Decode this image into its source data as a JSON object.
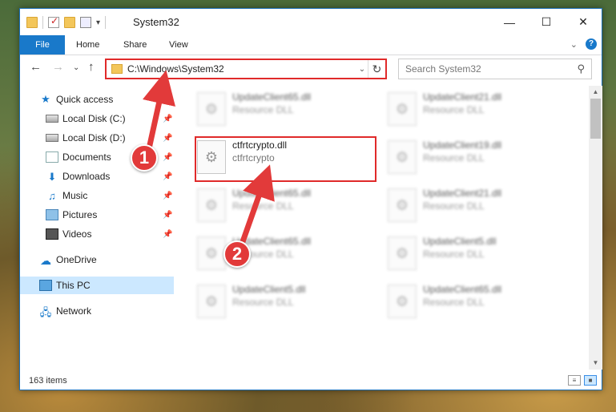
{
  "window": {
    "title": "System32"
  },
  "ribbon": {
    "tabs": [
      "File",
      "Home",
      "Share",
      "View"
    ],
    "help": "?"
  },
  "address": {
    "path": "C:\\Windows\\System32"
  },
  "search": {
    "placeholder": "Search System32"
  },
  "nav": {
    "items": [
      {
        "label": "Quick access",
        "icon": "star-icon"
      },
      {
        "label": "Local Disk (C:)",
        "icon": "drive-icon"
      },
      {
        "label": "Local Disk (D:)",
        "icon": "drive-icon"
      },
      {
        "label": "Documents",
        "icon": "documents-icon"
      },
      {
        "label": "Downloads",
        "icon": "downloads-icon"
      },
      {
        "label": "Music",
        "icon": "music-icon"
      },
      {
        "label": "Pictures",
        "icon": "pictures-icon"
      },
      {
        "label": "Videos",
        "icon": "videos-icon"
      },
      {
        "label": "OneDrive",
        "icon": "cloud-icon"
      },
      {
        "label": "This PC",
        "icon": "computer-icon"
      },
      {
        "label": "Network",
        "icon": "network-icon"
      }
    ]
  },
  "files": [
    {
      "name": "UpdateClient65.dll",
      "type": "Resource DLL"
    },
    {
      "name": "UpdateClient21.dll",
      "type": "Resource DLL"
    },
    {
      "name": "ctfrtcrypto.dll",
      "type": "ctfrtcrypto"
    },
    {
      "name": "UpdateClient19.dll",
      "type": "Resource DLL"
    },
    {
      "name": "UpdateClient65.dll",
      "type": "Resource DLL"
    },
    {
      "name": "UpdateClient21.dll",
      "type": "Resource DLL"
    },
    {
      "name": "UpdateClient65.dll",
      "type": "Resource DLL"
    },
    {
      "name": "UpdateClient5.dll",
      "type": "Resource DLL"
    },
    {
      "name": "UpdateClient5.dll",
      "type": "Resource DLL"
    },
    {
      "name": "UpdateClient65.dll",
      "type": "Resource DLL"
    }
  ],
  "status": {
    "item_count": "163 items"
  },
  "annotations": {
    "step1": "1",
    "step2": "2",
    "arrow_color": "#e23a3a"
  }
}
